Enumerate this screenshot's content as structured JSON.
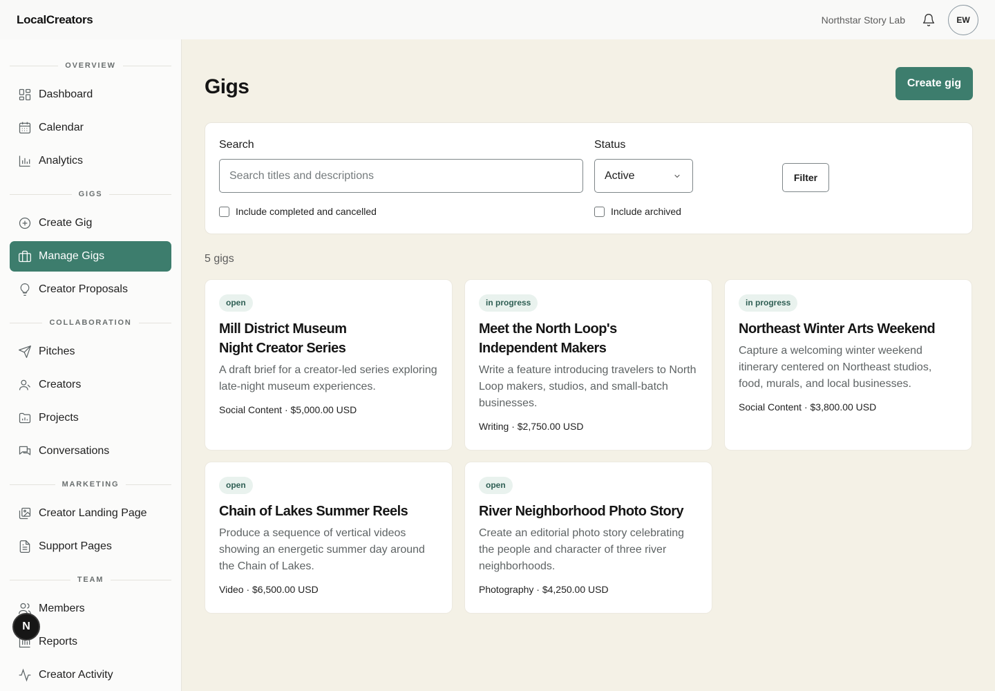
{
  "app": {
    "brand": "LocalCreators",
    "org_name": "Northstar Story Lab",
    "avatar_initials": "EW"
  },
  "sidebar": {
    "sections": [
      "OVERVIEW",
      "GIGS",
      "COLLABORATION",
      "MARKETING",
      "TEAM"
    ],
    "items": [
      {
        "label": "Dashboard",
        "icon": "dashboard-icon"
      },
      {
        "label": "Calendar",
        "icon": "calendar-icon"
      },
      {
        "label": "Analytics",
        "icon": "analytics-icon"
      },
      {
        "label": "Create Gig",
        "icon": "plus-circle-icon"
      },
      {
        "label": "Manage Gigs",
        "icon": "briefcase-icon",
        "active": true
      },
      {
        "label": "Creator Proposals",
        "icon": "lightbulb-icon"
      },
      {
        "label": "Pitches",
        "icon": "send-icon"
      },
      {
        "label": "Creators",
        "icon": "user-icon"
      },
      {
        "label": "Projects",
        "icon": "folder-icon"
      },
      {
        "label": "Conversations",
        "icon": "chat-icon"
      },
      {
        "label": "Creator Landing Page",
        "icon": "images-icon"
      },
      {
        "label": "Support Pages",
        "icon": "document-icon"
      },
      {
        "label": "Members",
        "icon": "users-icon"
      },
      {
        "label": "Reports",
        "icon": "reports-icon"
      },
      {
        "label": "Creator Activity",
        "icon": "activity-icon"
      }
    ],
    "floating_badge": "N"
  },
  "page": {
    "title": "Gigs",
    "create_button": "Create gig",
    "filters": {
      "search_label": "Search",
      "search_placeholder": "Search titles and descriptions",
      "search_value": "",
      "status_label": "Status",
      "status_value": "Active",
      "filter_button": "Filter",
      "include_completed": "Include completed and cancelled",
      "include_archived": "Include archived"
    },
    "count": "5 gigs"
  },
  "gigs": [
    {
      "status": "open",
      "title": "Mill District Museum Night Creator Series",
      "description": "A draft brief for a creator-led series exploring late-night museum experiences.",
      "meta": "Social Content · $5,000.00 USD"
    },
    {
      "status": "in progress",
      "title": "Meet the North Loop's Independent Makers",
      "description": "Write a feature introducing travelers to North Loop makers, studios, and small-batch businesses.",
      "meta": "Writing · $2,750.00 USD"
    },
    {
      "status": "in progress",
      "title": "Northeast Winter Arts Weekend",
      "description": "Capture a welcoming winter weekend itinerary centered on Northeast studios, food, murals, and local businesses.",
      "meta": "Social Content · $3,800.00 USD"
    },
    {
      "status": "open",
      "title": "Chain of Lakes Summer Reels",
      "description": "Produce a sequence of vertical videos showing an energetic summer day around the Chain of Lakes.",
      "meta": "Video · $6,500.00 USD"
    },
    {
      "status": "open",
      "title": "River Neighborhood Photo Story",
      "description": "Create an editorial photo story celebrating the people and character of three river neighborhoods.",
      "meta": "Photography · $4,250.00 USD"
    }
  ],
  "colors": {
    "accent": "#3d7d6d",
    "background": "#f4f1e6",
    "badge_bg": "#e9f2ee"
  }
}
